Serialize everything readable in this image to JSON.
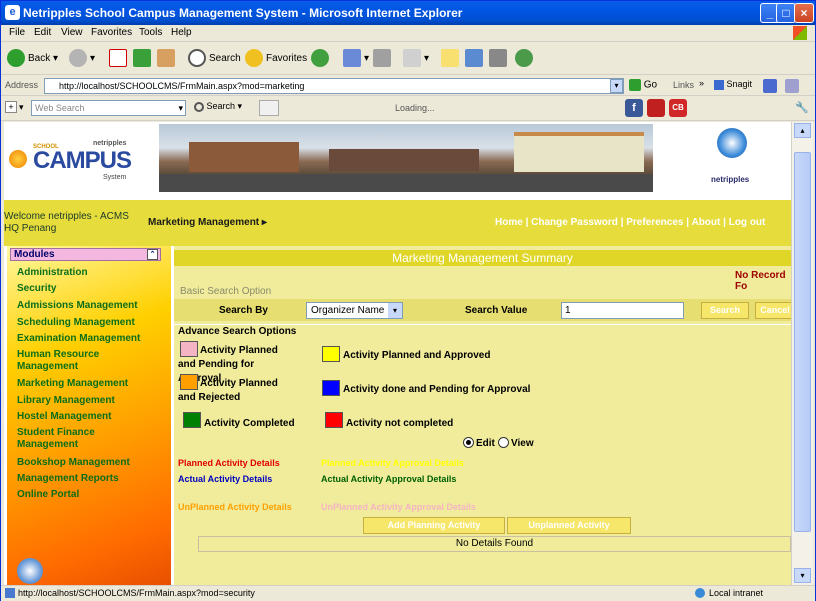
{
  "window": {
    "title": "Netripples School Campus Management System - Microsoft Internet Explorer"
  },
  "menu": [
    "File",
    "Edit",
    "View",
    "Favorites",
    "Tools",
    "Help"
  ],
  "toolbar": {
    "back": "Back",
    "search": "Search",
    "favorites": "Favorites"
  },
  "address": {
    "label": "Address",
    "url": "http://localhost/SCHOOLCMS/FrmMain.aspx?mod=marketing",
    "go": "Go",
    "links": "Links",
    "snagit": "Snagit"
  },
  "linksbar": {
    "web_search_placeholder": "Web Search",
    "search": "Search",
    "loading": "Loading..."
  },
  "header": {
    "logo_school": "SCHOOL",
    "logo_campus": "CAMPUS",
    "logo_system": "System",
    "logo_brand": "netripples",
    "right_brand": "netripples"
  },
  "nav": {
    "welcome": "Welcome netripples - ACMS HQ Penang",
    "module": "Marketing Management",
    "links": [
      "Home",
      "Change Password",
      "Preferences",
      "About",
      "Log out"
    ]
  },
  "sidebar": {
    "header": "Modules",
    "items": [
      "Administration",
      "Security",
      "Admissions Management",
      "Scheduling Management",
      "Examination Management",
      "Human Resource Management",
      "Marketing Management",
      "Library Management",
      "Hostel Management",
      "Student Finance Management",
      "Bookshop Management",
      "Management Reports",
      "Online Portal"
    ]
  },
  "main": {
    "title": "Marketing Management Summary",
    "no_record": "No Record Fo",
    "basic_search": "Basic Search Option",
    "search_by_label": "Search By",
    "search_by_value": "Organizer Name",
    "search_value_label": "Search Value",
    "search_value": "1",
    "search_button": "Search",
    "cancel_button": "Cancel",
    "advance_search": "Advance Search Options",
    "legend": [
      {
        "label": "Activity Planned and Pending for Approval",
        "color": "#f4b4c4"
      },
      {
        "label": "Activity Planned and Approved",
        "color": "#ffff00"
      },
      {
        "label": "Activity Planned and Rejected",
        "color": "#ffa000"
      },
      {
        "label": "Activity done and Pending for Approval",
        "color": "#0000ff"
      },
      {
        "label": "Activity Completed",
        "color": "#008000"
      },
      {
        "label": "Activity not completed",
        "color": "#ff0000"
      }
    ],
    "mode": {
      "edit": "Edit",
      "view": "View",
      "selected": "Edit"
    },
    "links": {
      "planned_details": "Planned Activity Details",
      "planned_approval": "Planned Activity Approval Details",
      "actual_details": "Actual Activity Details",
      "actual_approval": "Actual Activity Approval Details",
      "unplanned_details": "UnPlanned Activity Details",
      "unplanned_approval": "UnPlanned Activity Approval Details"
    },
    "add_planning_button": "Add Planning Activity",
    "unplanned_button": "Unplanned Activity",
    "no_details": "No Details Found"
  },
  "status": {
    "url": "http://localhost/SCHOOLCMS/FrmMain.aspx?mod=security",
    "zone": "Local intranet"
  }
}
